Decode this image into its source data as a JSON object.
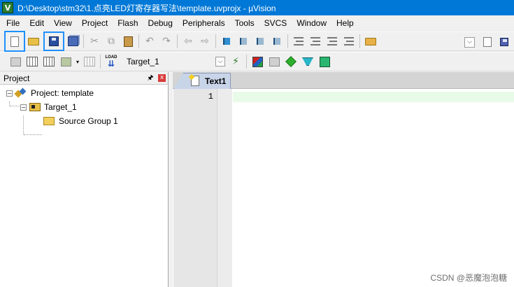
{
  "titlebar": {
    "app_icon_glyph": "V",
    "title": "D:\\Desktop\\stm32\\1.点亮LED灯寄存器写法\\template.uvprojx - µVision"
  },
  "menu": [
    "File",
    "Edit",
    "View",
    "Project",
    "Flash",
    "Debug",
    "Peripherals",
    "Tools",
    "SVCS",
    "Window",
    "Help"
  ],
  "toolbar2": {
    "target_value": "Target_1",
    "load_label": "LOAD"
  },
  "project_panel": {
    "title": "Project",
    "pin_glyph": "🖈",
    "close_glyph": "x",
    "tree": {
      "project": {
        "expander": "−",
        "label": "Project: template"
      },
      "target": {
        "expander": "−",
        "label": "Target_1"
      },
      "group": {
        "label": "Source Group 1"
      }
    }
  },
  "editor": {
    "tab_label": "Text1",
    "line_numbers": [
      "1"
    ],
    "content": ""
  },
  "icons": {
    "combo_arrow": "⌵",
    "wand": "⚡",
    "undo": "↶",
    "redo": "↷",
    "back": "⇦",
    "forward": "⇨",
    "cut": "✂",
    "copy": "⧉"
  },
  "watermark": "CSDN @恶魔泡泡糖",
  "colors": {
    "titlebar_bg": "#0078d7",
    "highlight_outline": "#1e90ff",
    "current_line": "#e8fbe8"
  }
}
